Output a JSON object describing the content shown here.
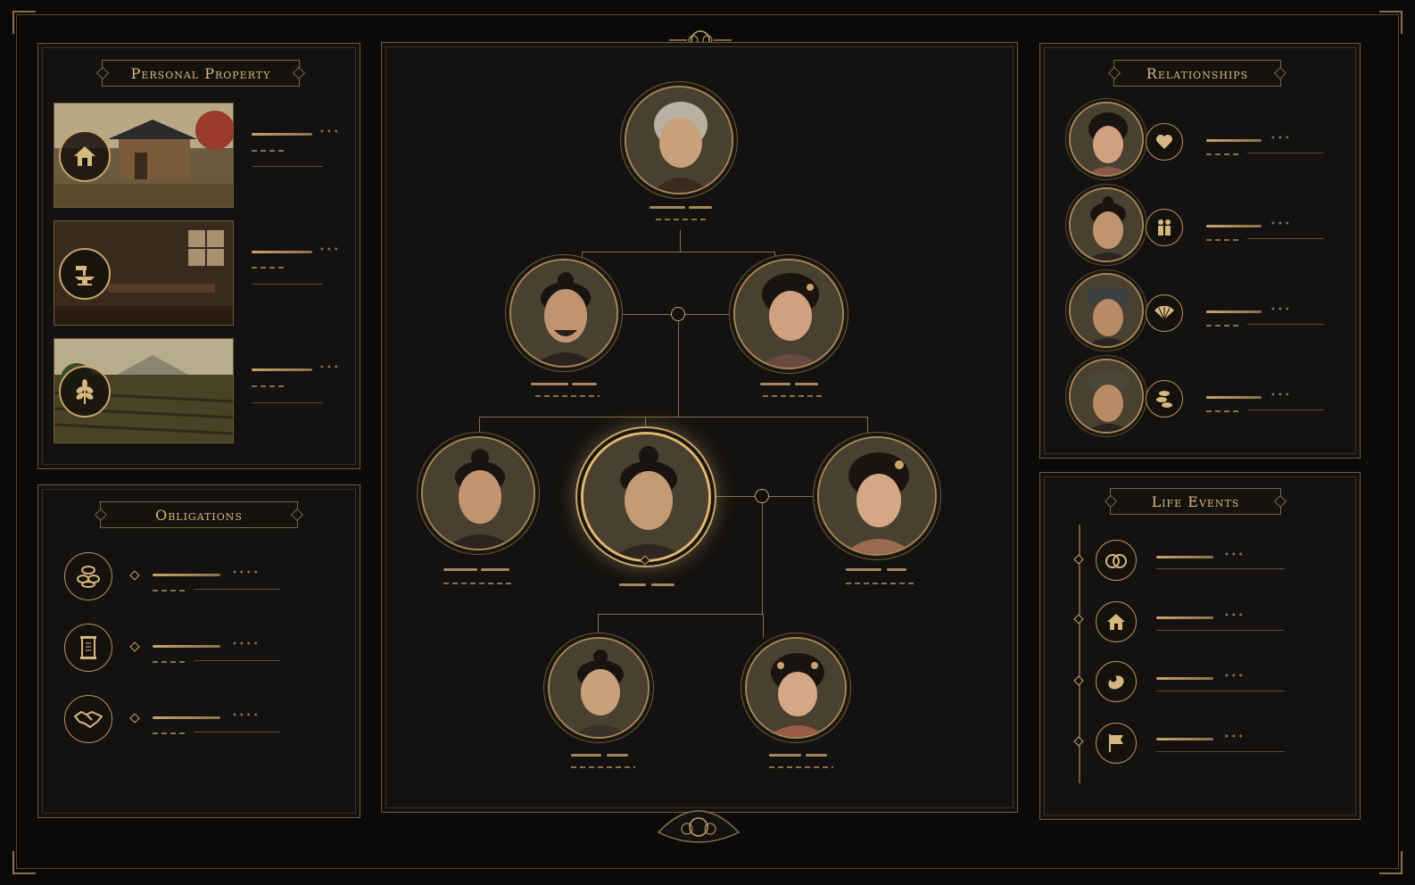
{
  "panels": {
    "property_title": "Personal Property",
    "obligations_title": "Obligations",
    "relationships_title": "Relationships",
    "life_events_title": "Life Events"
  },
  "property": [
    {
      "icon": "house-icon"
    },
    {
      "icon": "anvil-hammer-icon"
    },
    {
      "icon": "grain-icon"
    }
  ],
  "obligations": [
    {
      "icon": "coins-icon"
    },
    {
      "icon": "scroll-icon"
    },
    {
      "icon": "handshake-icon"
    }
  ],
  "relationships": [
    {
      "icon": "heart-icon"
    },
    {
      "icon": "family-icon"
    },
    {
      "icon": "fan-icon"
    },
    {
      "icon": "coins-icon"
    }
  ],
  "life_events": [
    {
      "icon": "rings-icon"
    },
    {
      "icon": "house-icon"
    },
    {
      "icon": "baby-icon"
    },
    {
      "icon": "flag-icon"
    }
  ],
  "colors": {
    "gold": "#c9a46a",
    "bg": "#0b0a08",
    "panel": "#141210",
    "highlight": "#e2b870"
  }
}
